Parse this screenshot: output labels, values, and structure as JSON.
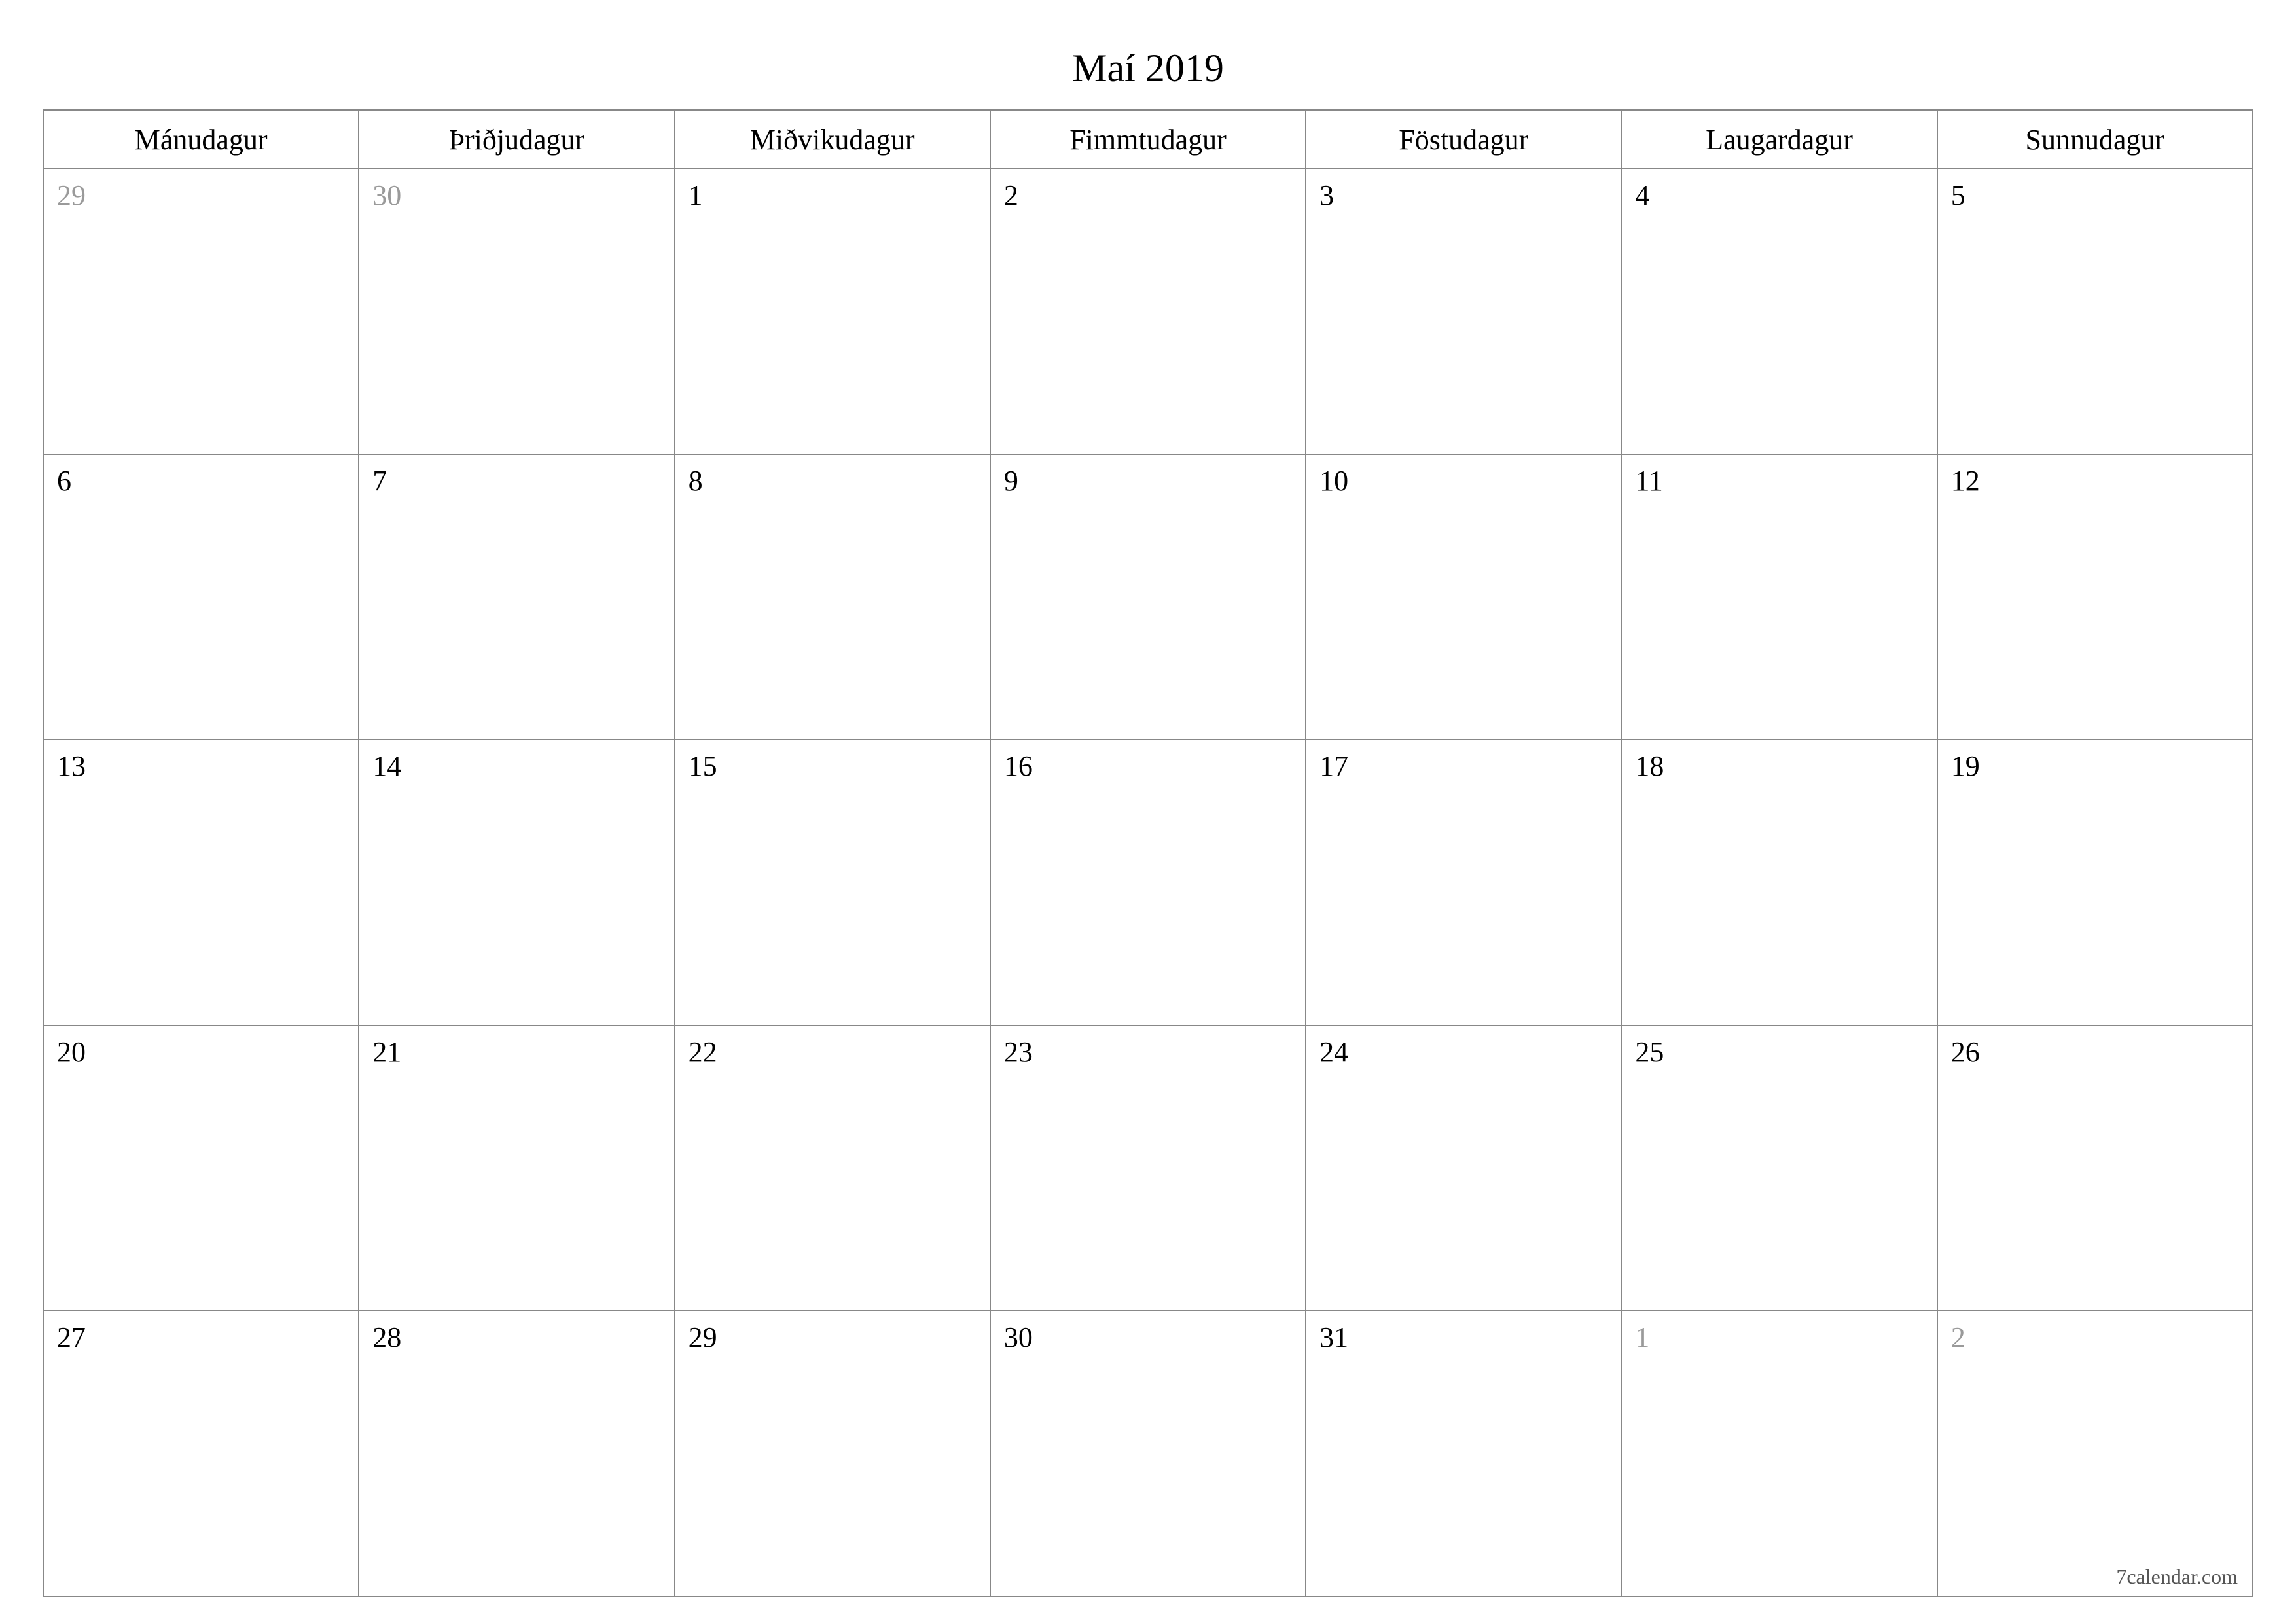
{
  "title": "Maí 2019",
  "weekdays": [
    "Mánudagur",
    "Þriðjudagur",
    "Miðvikudagur",
    "Fimmtudagur",
    "Föstudagur",
    "Laugardagur",
    "Sunnudagur"
  ],
  "weeks": [
    [
      {
        "day": "29",
        "other": true
      },
      {
        "day": "30",
        "other": true
      },
      {
        "day": "1",
        "other": false
      },
      {
        "day": "2",
        "other": false
      },
      {
        "day": "3",
        "other": false
      },
      {
        "day": "4",
        "other": false
      },
      {
        "day": "5",
        "other": false
      }
    ],
    [
      {
        "day": "6",
        "other": false
      },
      {
        "day": "7",
        "other": false
      },
      {
        "day": "8",
        "other": false
      },
      {
        "day": "9",
        "other": false
      },
      {
        "day": "10",
        "other": false
      },
      {
        "day": "11",
        "other": false
      },
      {
        "day": "12",
        "other": false
      }
    ],
    [
      {
        "day": "13",
        "other": false
      },
      {
        "day": "14",
        "other": false
      },
      {
        "day": "15",
        "other": false
      },
      {
        "day": "16",
        "other": false
      },
      {
        "day": "17",
        "other": false
      },
      {
        "day": "18",
        "other": false
      },
      {
        "day": "19",
        "other": false
      }
    ],
    [
      {
        "day": "20",
        "other": false
      },
      {
        "day": "21",
        "other": false
      },
      {
        "day": "22",
        "other": false
      },
      {
        "day": "23",
        "other": false
      },
      {
        "day": "24",
        "other": false
      },
      {
        "day": "25",
        "other": false
      },
      {
        "day": "26",
        "other": false
      }
    ],
    [
      {
        "day": "27",
        "other": false
      },
      {
        "day": "28",
        "other": false
      },
      {
        "day": "29",
        "other": false
      },
      {
        "day": "30",
        "other": false
      },
      {
        "day": "31",
        "other": false
      },
      {
        "day": "1",
        "other": true
      },
      {
        "day": "2",
        "other": true
      }
    ]
  ],
  "footer": "7calendar.com"
}
